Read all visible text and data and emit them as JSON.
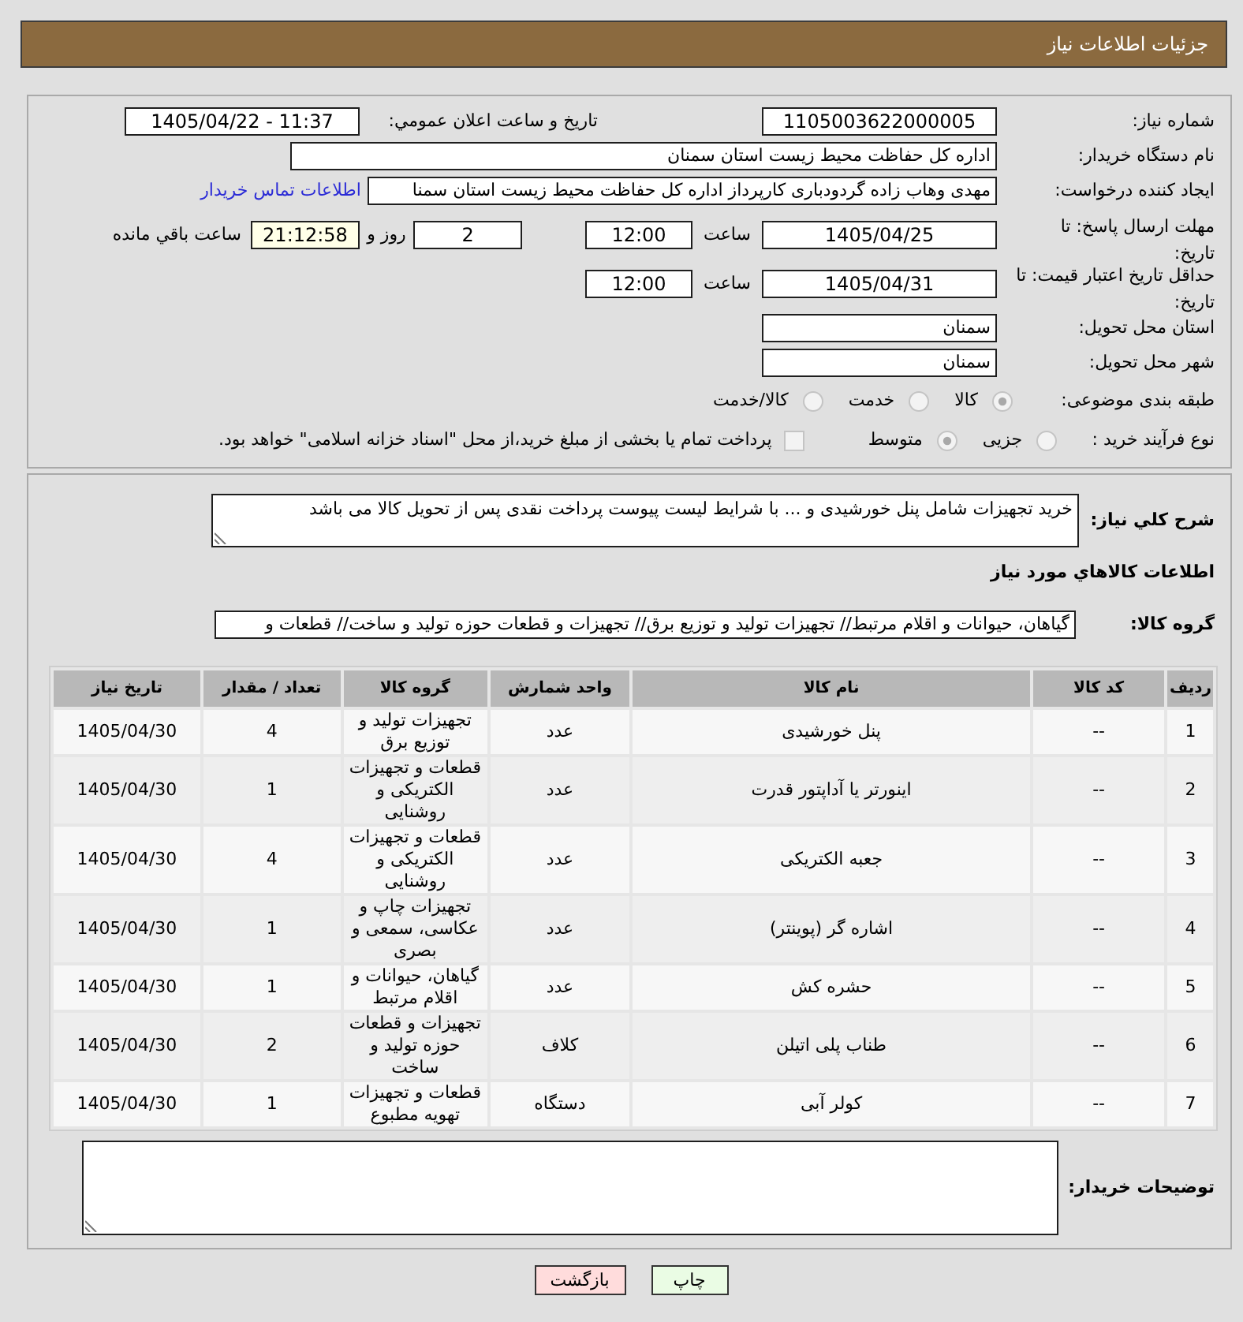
{
  "header": {
    "title": "جزئیات اطلاعات نیاز"
  },
  "form": {
    "need_number": {
      "label": "شماره نیاز:",
      "value": "1105003622000005"
    },
    "announcement": {
      "label": "تاریخ و ساعت اعلان عمومي:",
      "value": "1405/04/22 - 11:37"
    },
    "buyer_org": {
      "label": "نام دستگاه خریدار:",
      "value": "اداره کل حفاظت محیط زیست استان سمنان"
    },
    "requester": {
      "label": "ایجاد کننده درخواست:",
      "value": "مهدی وهاب زاده گردودباری کارپرداز اداره کل حفاظت محیط زیست استان سمنا",
      "link": "اطلاعات تماس خریدار"
    },
    "response_deadline": {
      "label": "مهلت ارسال پاسخ: تا تاریخ:",
      "date": "1405/04/25",
      "time_label": "ساعت",
      "time": "12:00",
      "days": "2",
      "days_label": "روز و",
      "remaining": "21:12:58",
      "remaining_label": "ساعت باقي مانده"
    },
    "price_validity": {
      "label": "حداقل تاریخ اعتبار قیمت: تا تاریخ:",
      "date": "1405/04/31",
      "time_label": "ساعت",
      "time": "12:00"
    },
    "delivery_province": {
      "label": "استان محل تحویل:",
      "value": "سمنان"
    },
    "delivery_city": {
      "label": "شهر محل تحویل:",
      "value": "سمنان"
    },
    "category": {
      "label": "طبقه بندی موضوعی:",
      "options": [
        {
          "label": "کالا",
          "selected": true
        },
        {
          "label": "خدمت",
          "selected": false
        },
        {
          "label": "کالا/خدمت",
          "selected": false
        }
      ]
    },
    "purchase_process": {
      "label": "نوع فرآیند خرید :",
      "options": [
        {
          "label": "جزیی",
          "selected": false
        },
        {
          "label": "متوسط",
          "selected": true
        }
      ],
      "treasury_payment": {
        "label": "پرداخت تمام یا بخشی از مبلغ خرید،از محل \"اسناد خزانه اسلامی\" خواهد بود.",
        "checked": false
      }
    }
  },
  "needs": {
    "description_label": "شرح کلي نیاز:",
    "description": "خرید تجهیزات شامل پنل خورشیدی و ... با شرایط لیست پیوست پرداخت نقدی پس از تحویل کالا می باشد",
    "goods_title": "اطلاعات کالاهاي مورد نیاز",
    "goods_group_label": "گروه کالا:",
    "goods_group": "گیاهان، حیوانات و اقلام مرتبط// تجهیزات تولید و توزیع برق// تجهیزات و قطعات حوزه تولید و ساخت// قطعات و",
    "table": {
      "columns": [
        "ردیف",
        "کد کالا",
        "نام کالا",
        "واحد شمارش",
        "گروه کالا",
        "تعداد / مقدار",
        "تاریخ نیاز"
      ],
      "rows": [
        [
          "1",
          "--",
          "پنل خورشیدی",
          "عدد",
          "تجهیزات تولید و توزیع برق",
          "4",
          "1405/04/30"
        ],
        [
          "2",
          "--",
          "اینورتر یا آداپتور قدرت",
          "عدد",
          "قطعات و تجهیزات الکتریکی و روشنایی",
          "1",
          "1405/04/30"
        ],
        [
          "3",
          "--",
          "جعبه الکتریکی",
          "عدد",
          "قطعات و تجهیزات الکتریکی و روشنایی",
          "4",
          "1405/04/30"
        ],
        [
          "4",
          "--",
          "اشاره گر (پوینتر)",
          "عدد",
          "تجهیزات چاپ و عکاسی، سمعی و بصری",
          "1",
          "1405/04/30"
        ],
        [
          "5",
          "--",
          "حشره کش",
          "عدد",
          "گیاهان، حیوانات و اقلام مرتبط",
          "1",
          "1405/04/30"
        ],
        [
          "6",
          "--",
          "طناب پلی اتیلن",
          "کلاف",
          "تجهیزات و قطعات حوزه تولید و ساخت",
          "2",
          "1405/04/30"
        ],
        [
          "7",
          "--",
          "کولر آبی",
          "دستگاه",
          "قطعات و تجهیزات تهویه مطبوع",
          "1",
          "1405/04/30"
        ]
      ]
    },
    "buyer_notes_label": "توضیحات خریدار:"
  },
  "buttons": [
    {
      "label": "چاپ",
      "kind": "print"
    },
    {
      "label": "بازگشت",
      "kind": "back"
    }
  ]
}
